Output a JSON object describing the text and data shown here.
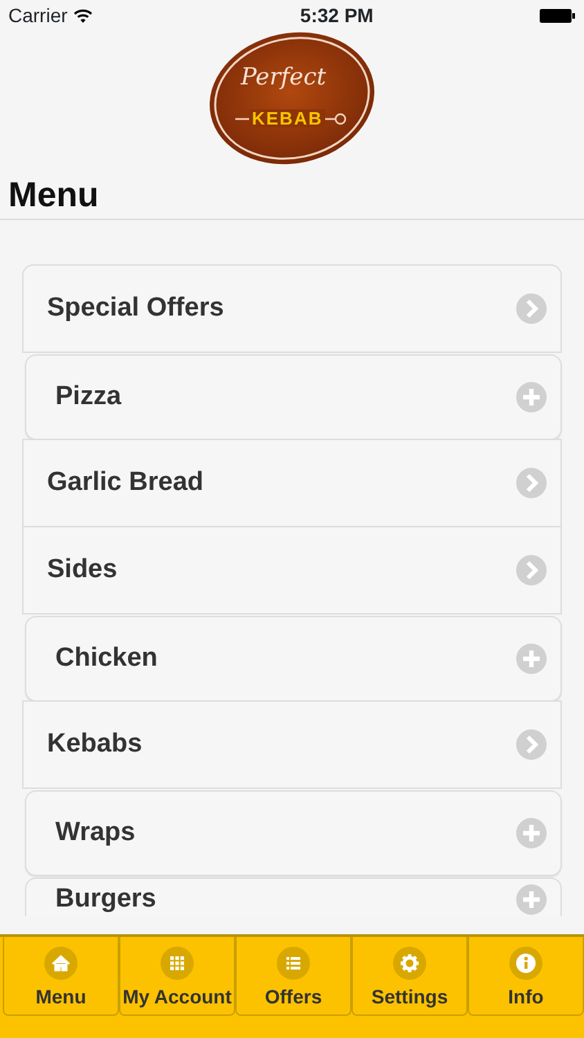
{
  "status_bar": {
    "carrier": "Carrier",
    "time": "5:32 PM"
  },
  "logo": {
    "script": "Perfect",
    "word": "KEBAB"
  },
  "title": "Menu",
  "items": [
    {
      "label": "Special Offers",
      "kind": "link"
    },
    {
      "label": "Pizza",
      "kind": "group"
    },
    {
      "label": "Garlic Bread",
      "kind": "link"
    },
    {
      "label": "Sides",
      "kind": "link"
    },
    {
      "label": "Chicken",
      "kind": "group"
    },
    {
      "label": "Kebabs",
      "kind": "link"
    },
    {
      "label": "Wraps",
      "kind": "group"
    },
    {
      "label": "Burgers",
      "kind": "group"
    }
  ],
  "tabs": [
    {
      "label": "Menu",
      "kind": "home",
      "selected": false
    },
    {
      "label": "My Account",
      "kind": "grid",
      "selected": false
    },
    {
      "label": "Offers",
      "kind": "list",
      "selected": false
    },
    {
      "label": "Settings",
      "kind": "gear",
      "selected": false
    },
    {
      "label": "Info",
      "kind": "info",
      "selected": false
    }
  ]
}
